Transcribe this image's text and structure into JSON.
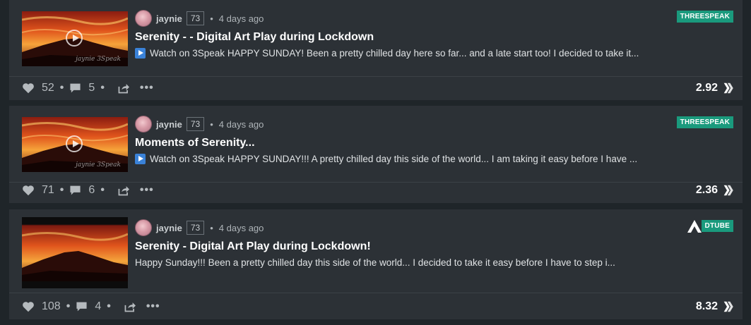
{
  "posts": [
    {
      "author": "jaynie",
      "reputation": "73",
      "time": "4 days ago",
      "title": "Serenity - - Digital Art Play during Lockdown",
      "snippet": "Watch on 3Speak HAPPY SUNDAY! Been a pretty chilled day here so far... and a late start too! I decided to take it...",
      "tag": "THREESPEAK",
      "likes": "52",
      "comments": "5",
      "payout": "2.92",
      "thumb_signature": "jaynie 3Speak",
      "has_play_badge": true
    },
    {
      "author": "jaynie",
      "reputation": "73",
      "time": "4 days ago",
      "title": "Moments of Serenity...",
      "snippet": "Watch on 3Speak HAPPY SUNDAY!!! A pretty chilled day this side of the world... I am taking it easy before I have ...",
      "tag": "THREESPEAK",
      "likes": "71",
      "comments": "6",
      "payout": "2.36",
      "thumb_signature": "jaynie 3Speak",
      "has_play_badge": true
    },
    {
      "author": "jaynie",
      "reputation": "73",
      "time": "4 days ago",
      "title": "Serenity - Digital Art Play during Lockdown!",
      "snippet": "Happy Sunday!!! Been a pretty chilled day this side of the world... I decided to take it easy before I have to step i...",
      "tag": "DTUBE",
      "likes": "108",
      "comments": "4",
      "payout": "8.32",
      "has_play_badge": false
    }
  ],
  "ui": {
    "meta_separator": "•",
    "footer_separator": "•",
    "more": "•••"
  },
  "colors": {
    "background": "#1f2529",
    "card": "#2c3136",
    "tag": "#1a9a7d",
    "play_badge": "#3a82d8"
  }
}
